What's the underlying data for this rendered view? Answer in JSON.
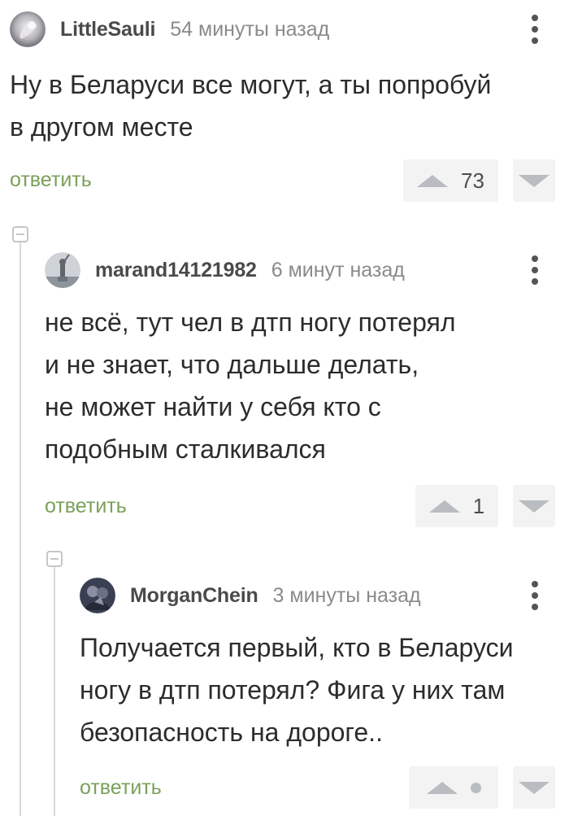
{
  "comments": [
    {
      "username": "LittleSauli",
      "time": "54 минуты назад",
      "text": "Ну в Беларуси все могут, а ты попробуй\nв другом месте",
      "reply_label": "ответить",
      "score": "73"
    },
    {
      "username": "marand14121982",
      "time": "6 минут назад",
      "text": "не всё, тут чел в дтп ногу потерял\nи не знает, что дальше делать,\nне может найти у себя кто с\nподобным сталкивался",
      "reply_label": "ответить",
      "score": "1"
    },
    {
      "username": "MorganChein",
      "time": "3 минуты назад",
      "text": "Получается первый, кто в Беларуси\nногу в дтп потерял? Фига у них там\nбезопасность на дороге..",
      "reply_label": "ответить",
      "score": null
    }
  ],
  "icons": {
    "menu": "more-vertical-icon",
    "vote_up": "triangle-up-icon",
    "vote_down": "triangle-down-icon",
    "collapse": "collapse-minus-icon"
  },
  "colors": {
    "reply": "#7aa05a",
    "text": "#2c2c2c",
    "meta": "#8a8a8a",
    "vote_bg": "#f3f3f3",
    "vote_arrow": "#b9bcc0"
  }
}
